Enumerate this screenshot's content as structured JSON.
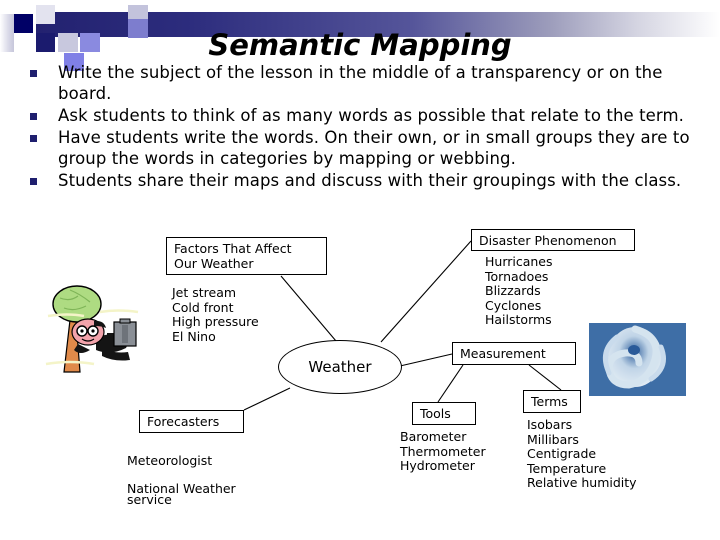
{
  "slide": {
    "title": "Semantic Mapping",
    "bullets": [
      "Write the subject of the lesson in the middle of a transparency or on the board.",
      "Ask students to think of as many words as possible that relate to the term.",
      "Have students write the words. On their own, or in small groups they are to group the words in categories by mapping or webbing.",
      "Students share their maps and discuss with their groupings with the class."
    ]
  },
  "concept_map": {
    "center_node": "Weather",
    "nodes": {
      "factors": {
        "box_label": "Factors That Affect\nOur Weather",
        "items": "Jet stream\nCold front\nHigh pressure\nEl Nino"
      },
      "disaster": {
        "box_label": "Disaster Phenomenon",
        "items": "Hurricanes\nTornadoes\nBlizzards\nCyclones\nHailstorms"
      },
      "measurement": {
        "box_label": "Measurement"
      },
      "tools": {
        "box_label": "Tools",
        "items": "Barometer\nThermometer\nHydrometer"
      },
      "terms": {
        "box_label": "Terms",
        "items": "Isobars\nMillibars\nCentigrade\nTemperature\nRelative humidity"
      },
      "forecasters": {
        "box_label": "Forecasters",
        "items_line1": "Meteorologist",
        "items_line2": "National Weather",
        "items_line3": "service"
      }
    }
  },
  "colors": {
    "band_dark": "#232270",
    "band_light": "#ffffff",
    "bullet_marker": "#1f1f6e",
    "deco_navy": "#000066",
    "deco_lavender": "#c3c3dc",
    "deco_periwinkle": "#8080e6",
    "hurricane_blue": "#3f6fa8",
    "tree_green": "#a8d97f",
    "tree_trunk": "#e08a4a",
    "face_pink": "#f2a0a8"
  }
}
